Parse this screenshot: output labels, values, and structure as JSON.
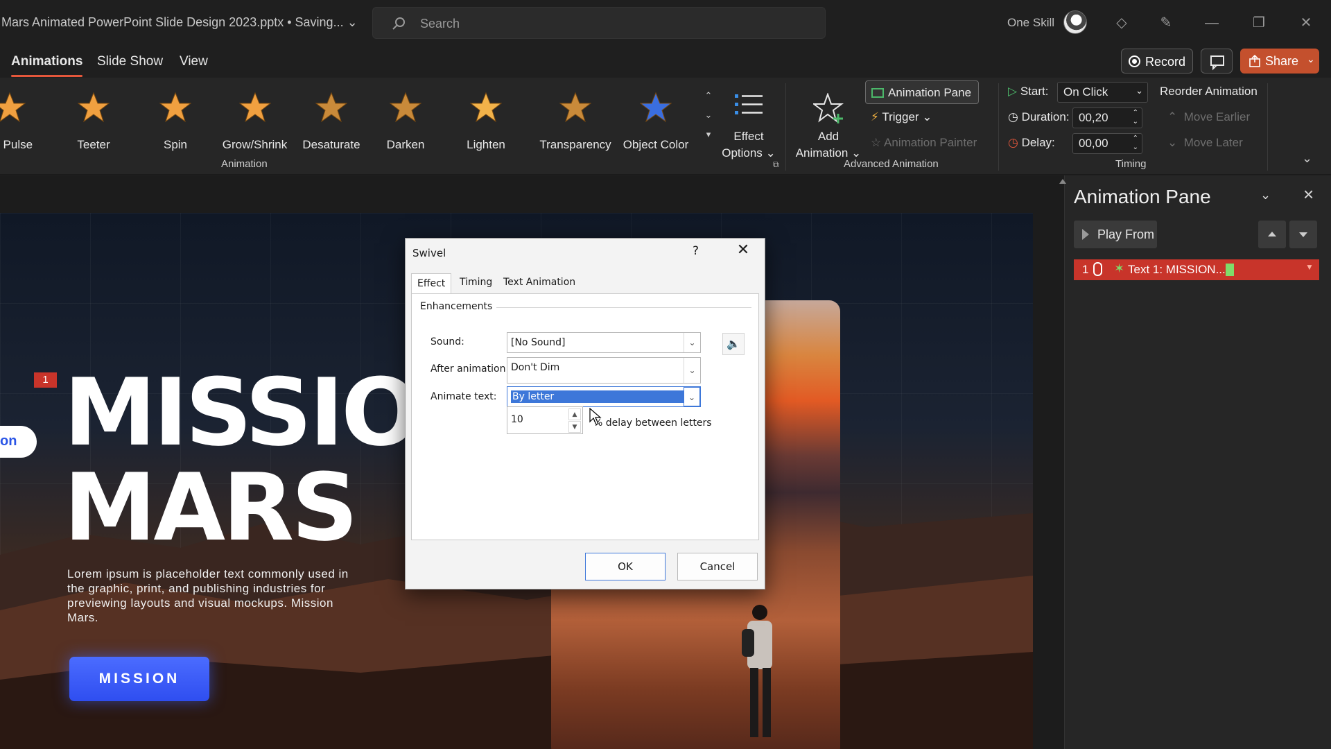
{
  "titlebar": {
    "doc_title": "Mars Animated PowerPoint Slide Design 2023.pptx • Saving...",
    "search_placeholder": "Search",
    "user_name": "One Skill"
  },
  "tabs": {
    "animations": "Animations",
    "slide_show": "Slide Show",
    "view": "View"
  },
  "actions": {
    "record": "Record",
    "share": "Share"
  },
  "ribbon": {
    "effects": [
      {
        "label": "lor Pulse",
        "color": "#f0a040"
      },
      {
        "label": "Teeter",
        "color": "#f0a040"
      },
      {
        "label": "Spin",
        "color": "#f0a040"
      },
      {
        "label": "Grow/Shrink",
        "color": "#f0a040"
      },
      {
        "label": "Desaturate",
        "color": "#c98a3a"
      },
      {
        "label": "Darken",
        "color": "#c98a3a"
      },
      {
        "label": "Lighten",
        "color": "#f2b24a"
      },
      {
        "label": "Transparency",
        "color": "#c98a3a"
      },
      {
        "label": "Object Color",
        "color": "#3a6ee0"
      }
    ],
    "effect_options": [
      "Effect",
      "Options"
    ],
    "animation_group": "Animation",
    "add_animation": [
      "Add",
      "Animation"
    ],
    "animation_pane_btn": "Animation Pane",
    "trigger": "Trigger",
    "animation_painter": "Animation Painter",
    "advanced_group": "Advanced Animation",
    "start_label": "Start:",
    "start_value": "On Click",
    "duration_label": "Duration:",
    "duration_value": "00,20",
    "delay_label": "Delay:",
    "delay_value": "00,00",
    "timing_group": "Timing",
    "reorder": "Reorder Animation",
    "move_earlier": "Move Earlier",
    "move_later": "Move Later"
  },
  "slide": {
    "pill_text": "on",
    "anim_tag": "1",
    "title_line1": "MISSIO",
    "title_line2": "MARS",
    "body": "Lorem ipsum is placeholder text commonly used in the graphic, print, and publishing industries for previewing layouts and visual mockups. Mission Mars.",
    "button": "MISSION"
  },
  "dialog": {
    "title": "Swivel",
    "help": "?",
    "tabs": [
      "Effect",
      "Timing",
      "Text Animation"
    ],
    "enhancements": "Enhancements",
    "sound_label": "Sound:",
    "sound_value": "[No Sound]",
    "after_label": "After animation:",
    "after_value": "Don't Dim",
    "animate_label": "Animate text:",
    "animate_value": "By letter",
    "delay_value": "10",
    "delay_label": "% delay between letters",
    "ok": "OK",
    "cancel": "Cancel"
  },
  "pane": {
    "title": "Animation Pane",
    "play_from": "Play From",
    "item_number": "1",
    "item_label": "Text 1: MISSION..."
  }
}
